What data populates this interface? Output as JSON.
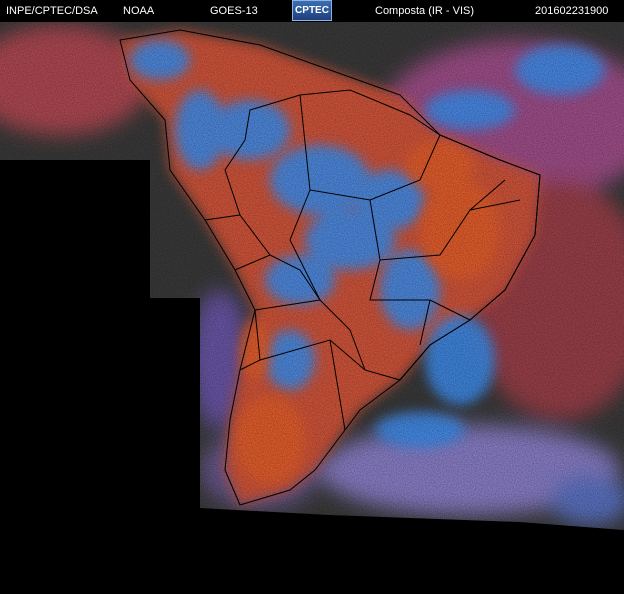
{
  "header": {
    "agency": "INPE/CPTEC/DSA",
    "provider": "NOAA",
    "satellite": "GOES-13",
    "logo_text": "CPTEC",
    "product": "Composta (IR - VIS)",
    "timestamp": "201602231900"
  },
  "colors": {
    "background": "#000000",
    "cloud_free": "#d2553a",
    "high_cloud": "#3f8ff0",
    "ocean_dark": "#3a3a3a",
    "cirrus": "#8a6fc4",
    "borders": "#000000"
  },
  "map": {
    "region": "south-america",
    "overlay": "country-and-state-boundaries"
  }
}
